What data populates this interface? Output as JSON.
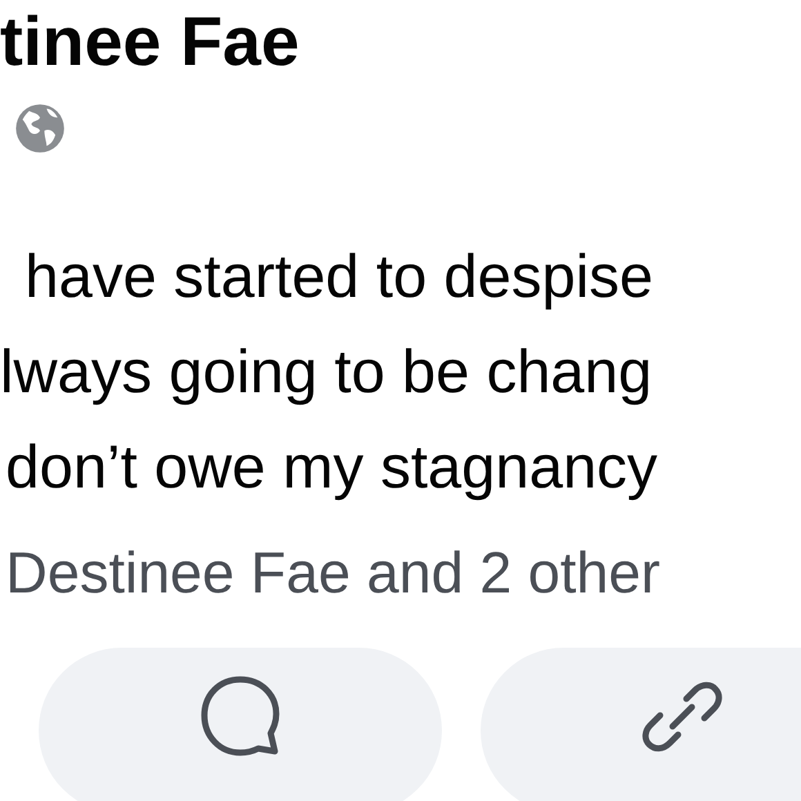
{
  "author": {
    "name": "tinee Fae"
  },
  "post": {
    "lines": [
      "have started to despise",
      "lways going to be chang",
      "don’t owe my stagnancy"
    ]
  },
  "reactions": {
    "text": "Destinee Fae and 2 other"
  },
  "actions": [
    {
      "kind": "comment"
    },
    {
      "kind": "share-link"
    }
  ]
}
